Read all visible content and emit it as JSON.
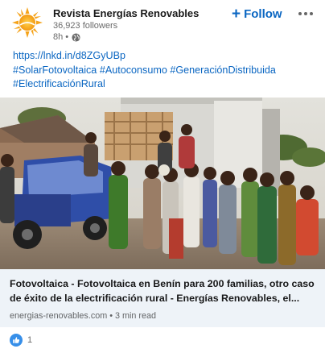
{
  "actor": {
    "name": "Revista Energías Renovables",
    "followers": "36,923 followers",
    "time": "8h •",
    "visibility_icon": "globe-icon"
  },
  "follow_button": {
    "label": "Follow",
    "icon": "plus-icon"
  },
  "more_button": {
    "icon": "more-horizontal-icon"
  },
  "commentary": {
    "link": "https://lnkd.in/d8ZGyUBp",
    "hashtags_line1": [
      "#SolarFotovoltaica",
      "#Autoconsumo",
      "#GeneraciónDistribuida"
    ],
    "hashtags_line2": [
      "#ElectrificaciónRural"
    ]
  },
  "article": {
    "title_line1": "Fotovoltaica - Fotovoltaica en Benín para 200 familias, otro caso",
    "title_line2": "de éxito de la electrificación rural - Energías Renovables, el...",
    "meta": "energias-renovables.com • 3 min read"
  },
  "social": {
    "reaction_icon": "like-reaction-icon",
    "count": "1"
  },
  "colors": {
    "accent": "#0a66c2",
    "article_bg": "#eef3f8",
    "logo_orange": "#f5a31a",
    "like_blue": "#378fe9"
  }
}
